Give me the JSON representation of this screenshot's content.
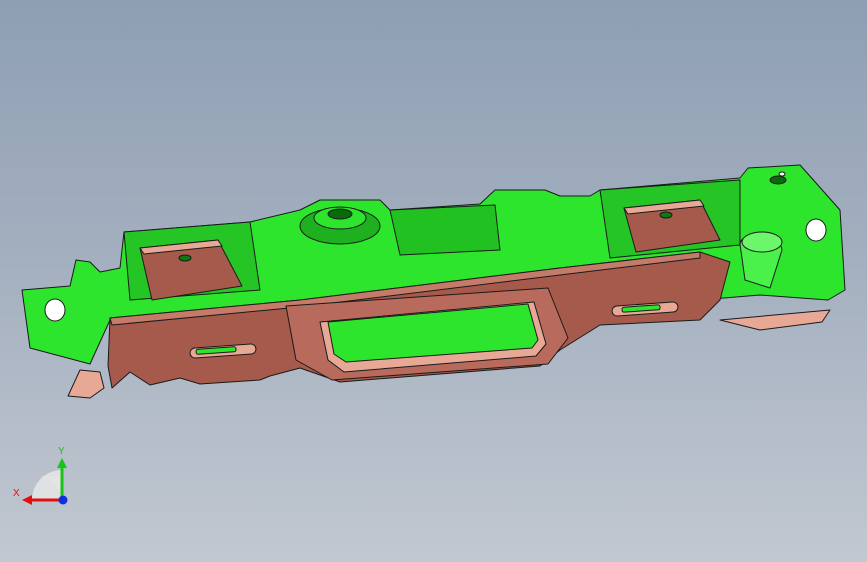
{
  "viewport": {
    "background_top": "#8e9fb3",
    "background_bottom": "#c2c8d1"
  },
  "model": {
    "part": "stamped-bracket",
    "colors": {
      "green_face": "#2ee52e",
      "green_dark": "#12a012",
      "copper_face": "#a65a4c",
      "copper_light": "#e7a896",
      "edge": "#1a1a1a"
    }
  },
  "triad": {
    "x_label": "X",
    "y_label": "Y",
    "x_color": "#e01010",
    "y_color": "#18c418",
    "z_color": "#1030e0"
  }
}
